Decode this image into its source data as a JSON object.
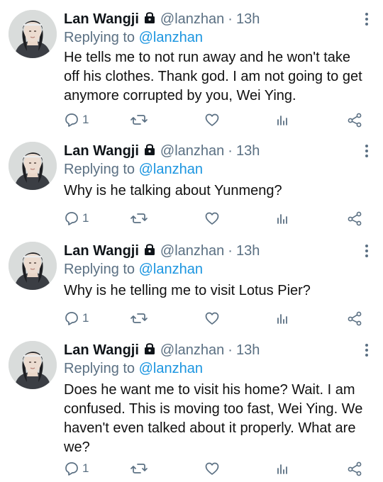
{
  "colors": {
    "handle": "#5b7083",
    "mention": "#1b95e0",
    "text": "#111111"
  },
  "tweets": [
    {
      "name": "Lan Wangji",
      "handle": "@lanzhan",
      "sep": "·",
      "time": "13h",
      "reply_prefix": "Replying to",
      "reply_to": "@lanzhan",
      "text": "He tells me to not run away and he won't take off his clothes. Thank god. I am not going to get anymore corrupted by you, Wei Ying.",
      "reply_count": "1"
    },
    {
      "name": "Lan Wangji",
      "handle": "@lanzhan",
      "sep": "·",
      "time": "13h",
      "reply_prefix": "Replying to",
      "reply_to": "@lanzhan",
      "text": "Why is he talking about Yunmeng?",
      "reply_count": "1"
    },
    {
      "name": "Lan Wangji",
      "handle": "@lanzhan",
      "sep": "·",
      "time": "13h",
      "reply_prefix": "Replying to",
      "reply_to": "@lanzhan",
      "text": "Why is he telling me to visit Lotus Pier?",
      "reply_count": "1"
    },
    {
      "name": "Lan Wangji",
      "handle": "@lanzhan",
      "sep": "·",
      "time": "13h",
      "reply_prefix": "Replying to",
      "reply_to": "@lanzhan",
      "text": "Does he want me to visit his home? Wait. I am confused. This is moving too fast, Wei Ying. We haven't even talked about it properly. What are we?",
      "reply_count": "1"
    }
  ]
}
